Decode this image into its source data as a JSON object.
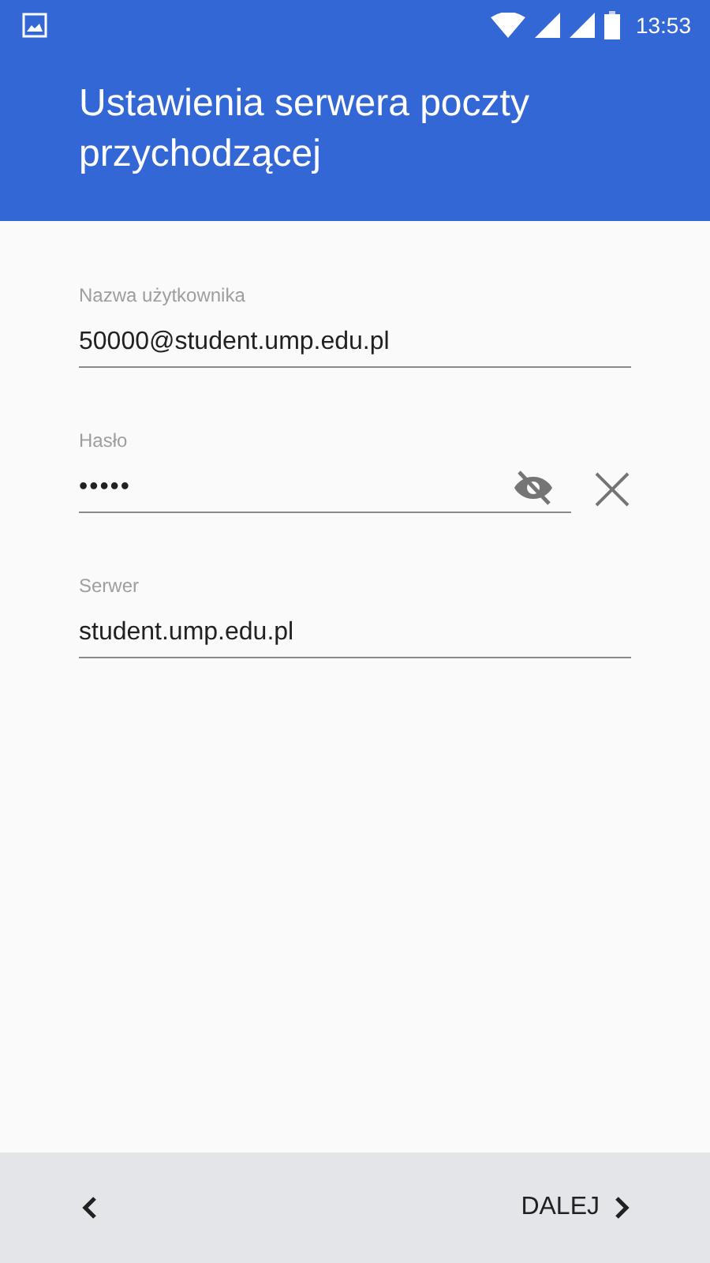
{
  "status_bar": {
    "time": "13:53"
  },
  "header": {
    "title": "Ustawienia serwera poczty przychodzącej"
  },
  "fields": [
    {
      "kind": "text",
      "label": "Nazwa użytkownika",
      "value": "50000@student.ump.edu.pl"
    },
    {
      "kind": "password",
      "label": "Hasło",
      "value": "•••••"
    },
    {
      "kind": "text",
      "label": "Serwer",
      "value": "student.ump.edu.pl"
    }
  ],
  "bottom_bar": {
    "next_label": "DALEJ"
  }
}
